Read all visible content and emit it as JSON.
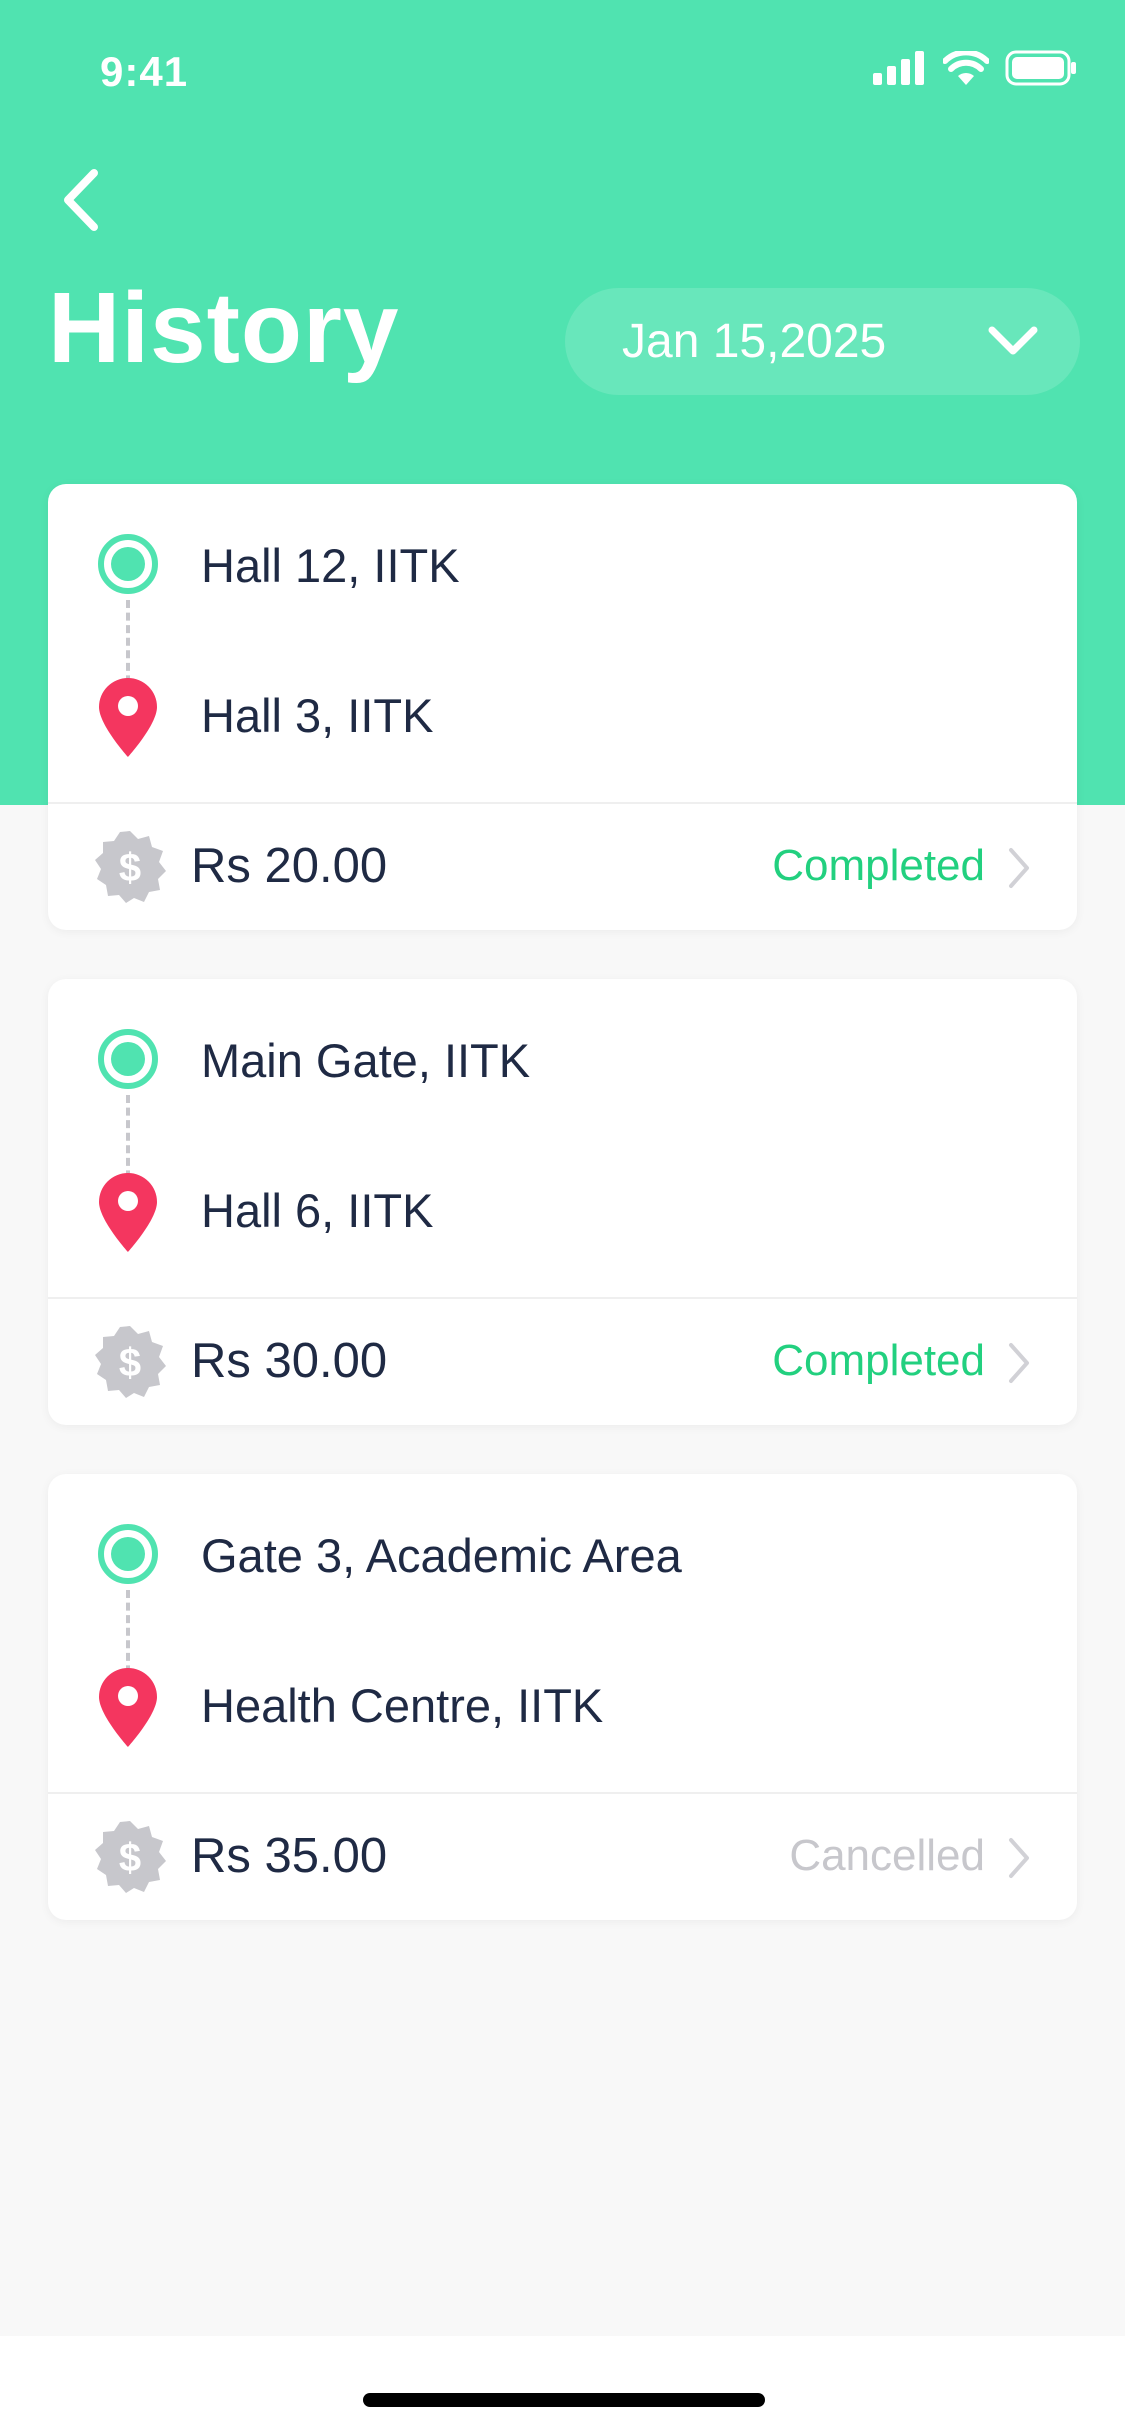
{
  "status_bar": {
    "time": "9:41"
  },
  "header": {
    "title": "History",
    "date": "Jan 15,2025"
  },
  "colors": {
    "accent": "#50e3b0",
    "completed": "#22d07f",
    "cancelled": "#c7c7cc",
    "destination": "#f4365f",
    "text": "#1f2a44"
  },
  "icons": {
    "back": "chevron-left-icon",
    "date_dropdown": "chevron-down-icon",
    "origin": "origin-ring-icon",
    "destination": "location-pin-icon",
    "fare": "dollar-badge-icon",
    "row": "chevron-right-icon"
  },
  "rides": [
    {
      "from": "Hall 12, IITK",
      "to": "Hall 3, IITK",
      "fare": "Rs 20.00",
      "status": "Completed"
    },
    {
      "from": "Main Gate, IITK",
      "to": "Hall 6, IITK",
      "fare": "Rs 30.00",
      "status": "Completed"
    },
    {
      "from": "Gate 3, Academic Area",
      "to": "Health Centre, IITK",
      "fare": "Rs 35.00",
      "status": "Cancelled"
    }
  ]
}
